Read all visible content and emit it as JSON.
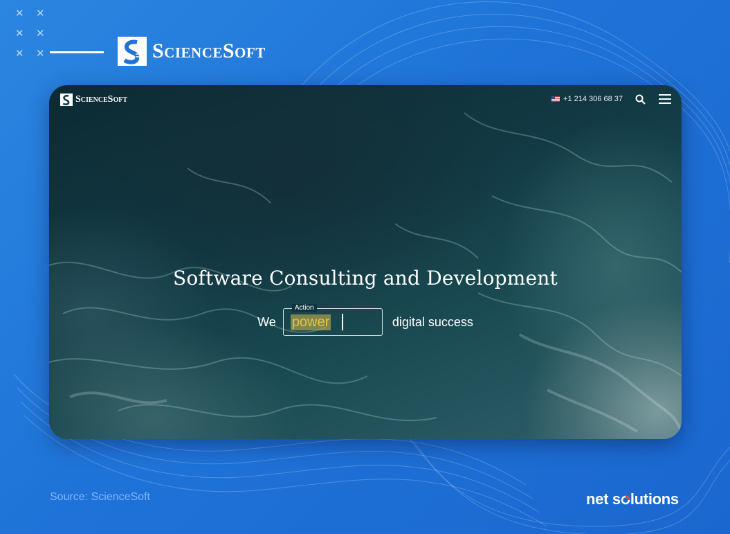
{
  "header": {
    "logo_text": "ScienceSoft"
  },
  "card": {
    "nav": {
      "logo_text": "ScienceSoft",
      "flag_icon": "us-flag-icon",
      "phone": "+1 214 306 68 37",
      "search_icon": "search-icon",
      "menu_icon": "hamburger-menu-icon"
    },
    "hero": {
      "title": "Software Consulting and Development",
      "prefix": "We",
      "action_label": "Action",
      "action_value": "power",
      "suffix": "digital success"
    }
  },
  "footer": {
    "source": "Source: ScienceSoft",
    "brand_part1": "net s",
    "brand_part2": "lutions"
  },
  "colors": {
    "background": "#1f73d8",
    "highlight": "#e8c24a",
    "source_text": "#7fb6ff"
  }
}
